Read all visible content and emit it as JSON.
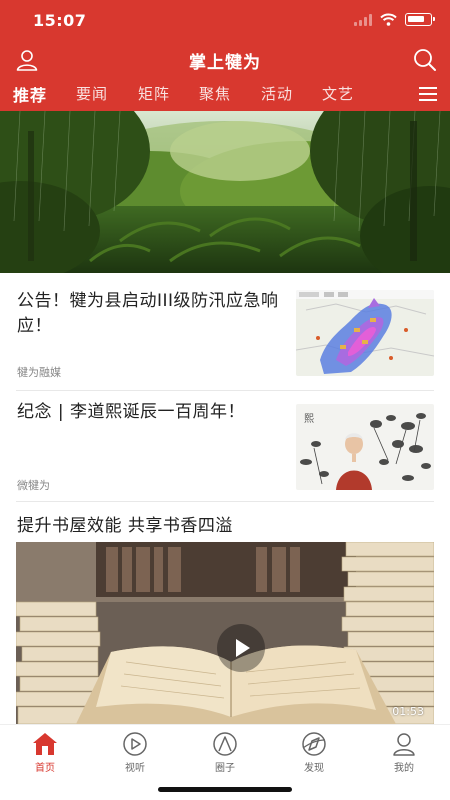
{
  "status_bar": {
    "time": "15:07"
  },
  "app": {
    "title": "掌上犍为"
  },
  "nav_tabs": [
    {
      "label": "推荐",
      "active": true
    },
    {
      "label": "要闻",
      "active": false
    },
    {
      "label": "矩阵",
      "active": false
    },
    {
      "label": "聚焦",
      "active": false
    },
    {
      "label": "活动",
      "active": false
    },
    {
      "label": "文艺",
      "active": false
    }
  ],
  "articles": [
    {
      "title": "公告！犍为县启动III级防汛应急响应！",
      "source": "犍为融媒"
    },
    {
      "title": "纪念 | 李道熙诞辰一百周年！",
      "source": "微犍为"
    }
  ],
  "video_article": {
    "title": "提升书屋效能  共享书香四溢",
    "duration": "01:53"
  },
  "bottom_tabs": [
    {
      "label": "首页",
      "icon": "home-icon",
      "active": true
    },
    {
      "label": "视听",
      "icon": "play-circle-icon",
      "active": false
    },
    {
      "label": "圈子",
      "icon": "circle-triangle-icon",
      "active": false
    },
    {
      "label": "发现",
      "icon": "compass-icon",
      "active": false
    },
    {
      "label": "我的",
      "icon": "profile-icon",
      "active": false
    }
  ],
  "colors": {
    "brand": "#d8382f",
    "text": "#222222",
    "muted": "#888888"
  }
}
